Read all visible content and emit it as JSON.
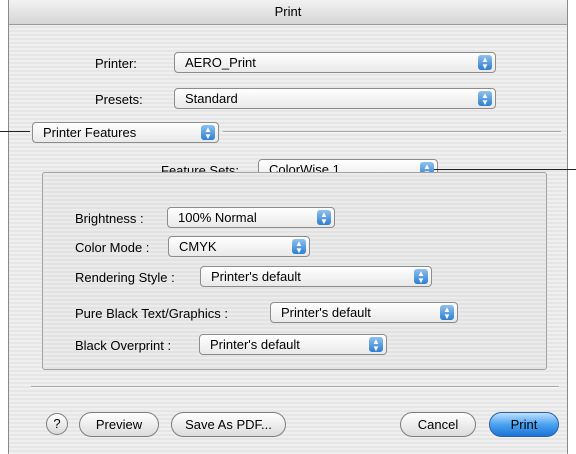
{
  "window": {
    "title": "Print"
  },
  "printer": {
    "label": "Printer:",
    "value": "AERO_Print"
  },
  "presets": {
    "label": "Presets:",
    "value": "Standard"
  },
  "panel_menu": {
    "value": "Printer Features"
  },
  "feature_sets": {
    "label": "Feature Sets:",
    "value": "ColorWise  1"
  },
  "options": [
    {
      "label": "Brightness :",
      "value": "100% Normal"
    },
    {
      "label": "Color Mode :",
      "value": "CMYK"
    },
    {
      "label": "Rendering Style :",
      "value": "Printer's default"
    },
    {
      "label": "Pure Black Text/Graphics :",
      "value": "Printer's default"
    },
    {
      "label": "Black Overprint :",
      "value": "Printer's default"
    }
  ],
  "footer": {
    "help": "?",
    "preview": "Preview",
    "save_pdf": "Save As PDF...",
    "cancel": "Cancel",
    "print": "Print"
  },
  "icons": {
    "popup_arrows": "up-down-arrows-icon",
    "help": "question-mark-icon"
  },
  "colors": {
    "accent": "#2d7fd1",
    "window_bg": "#ececec"
  }
}
